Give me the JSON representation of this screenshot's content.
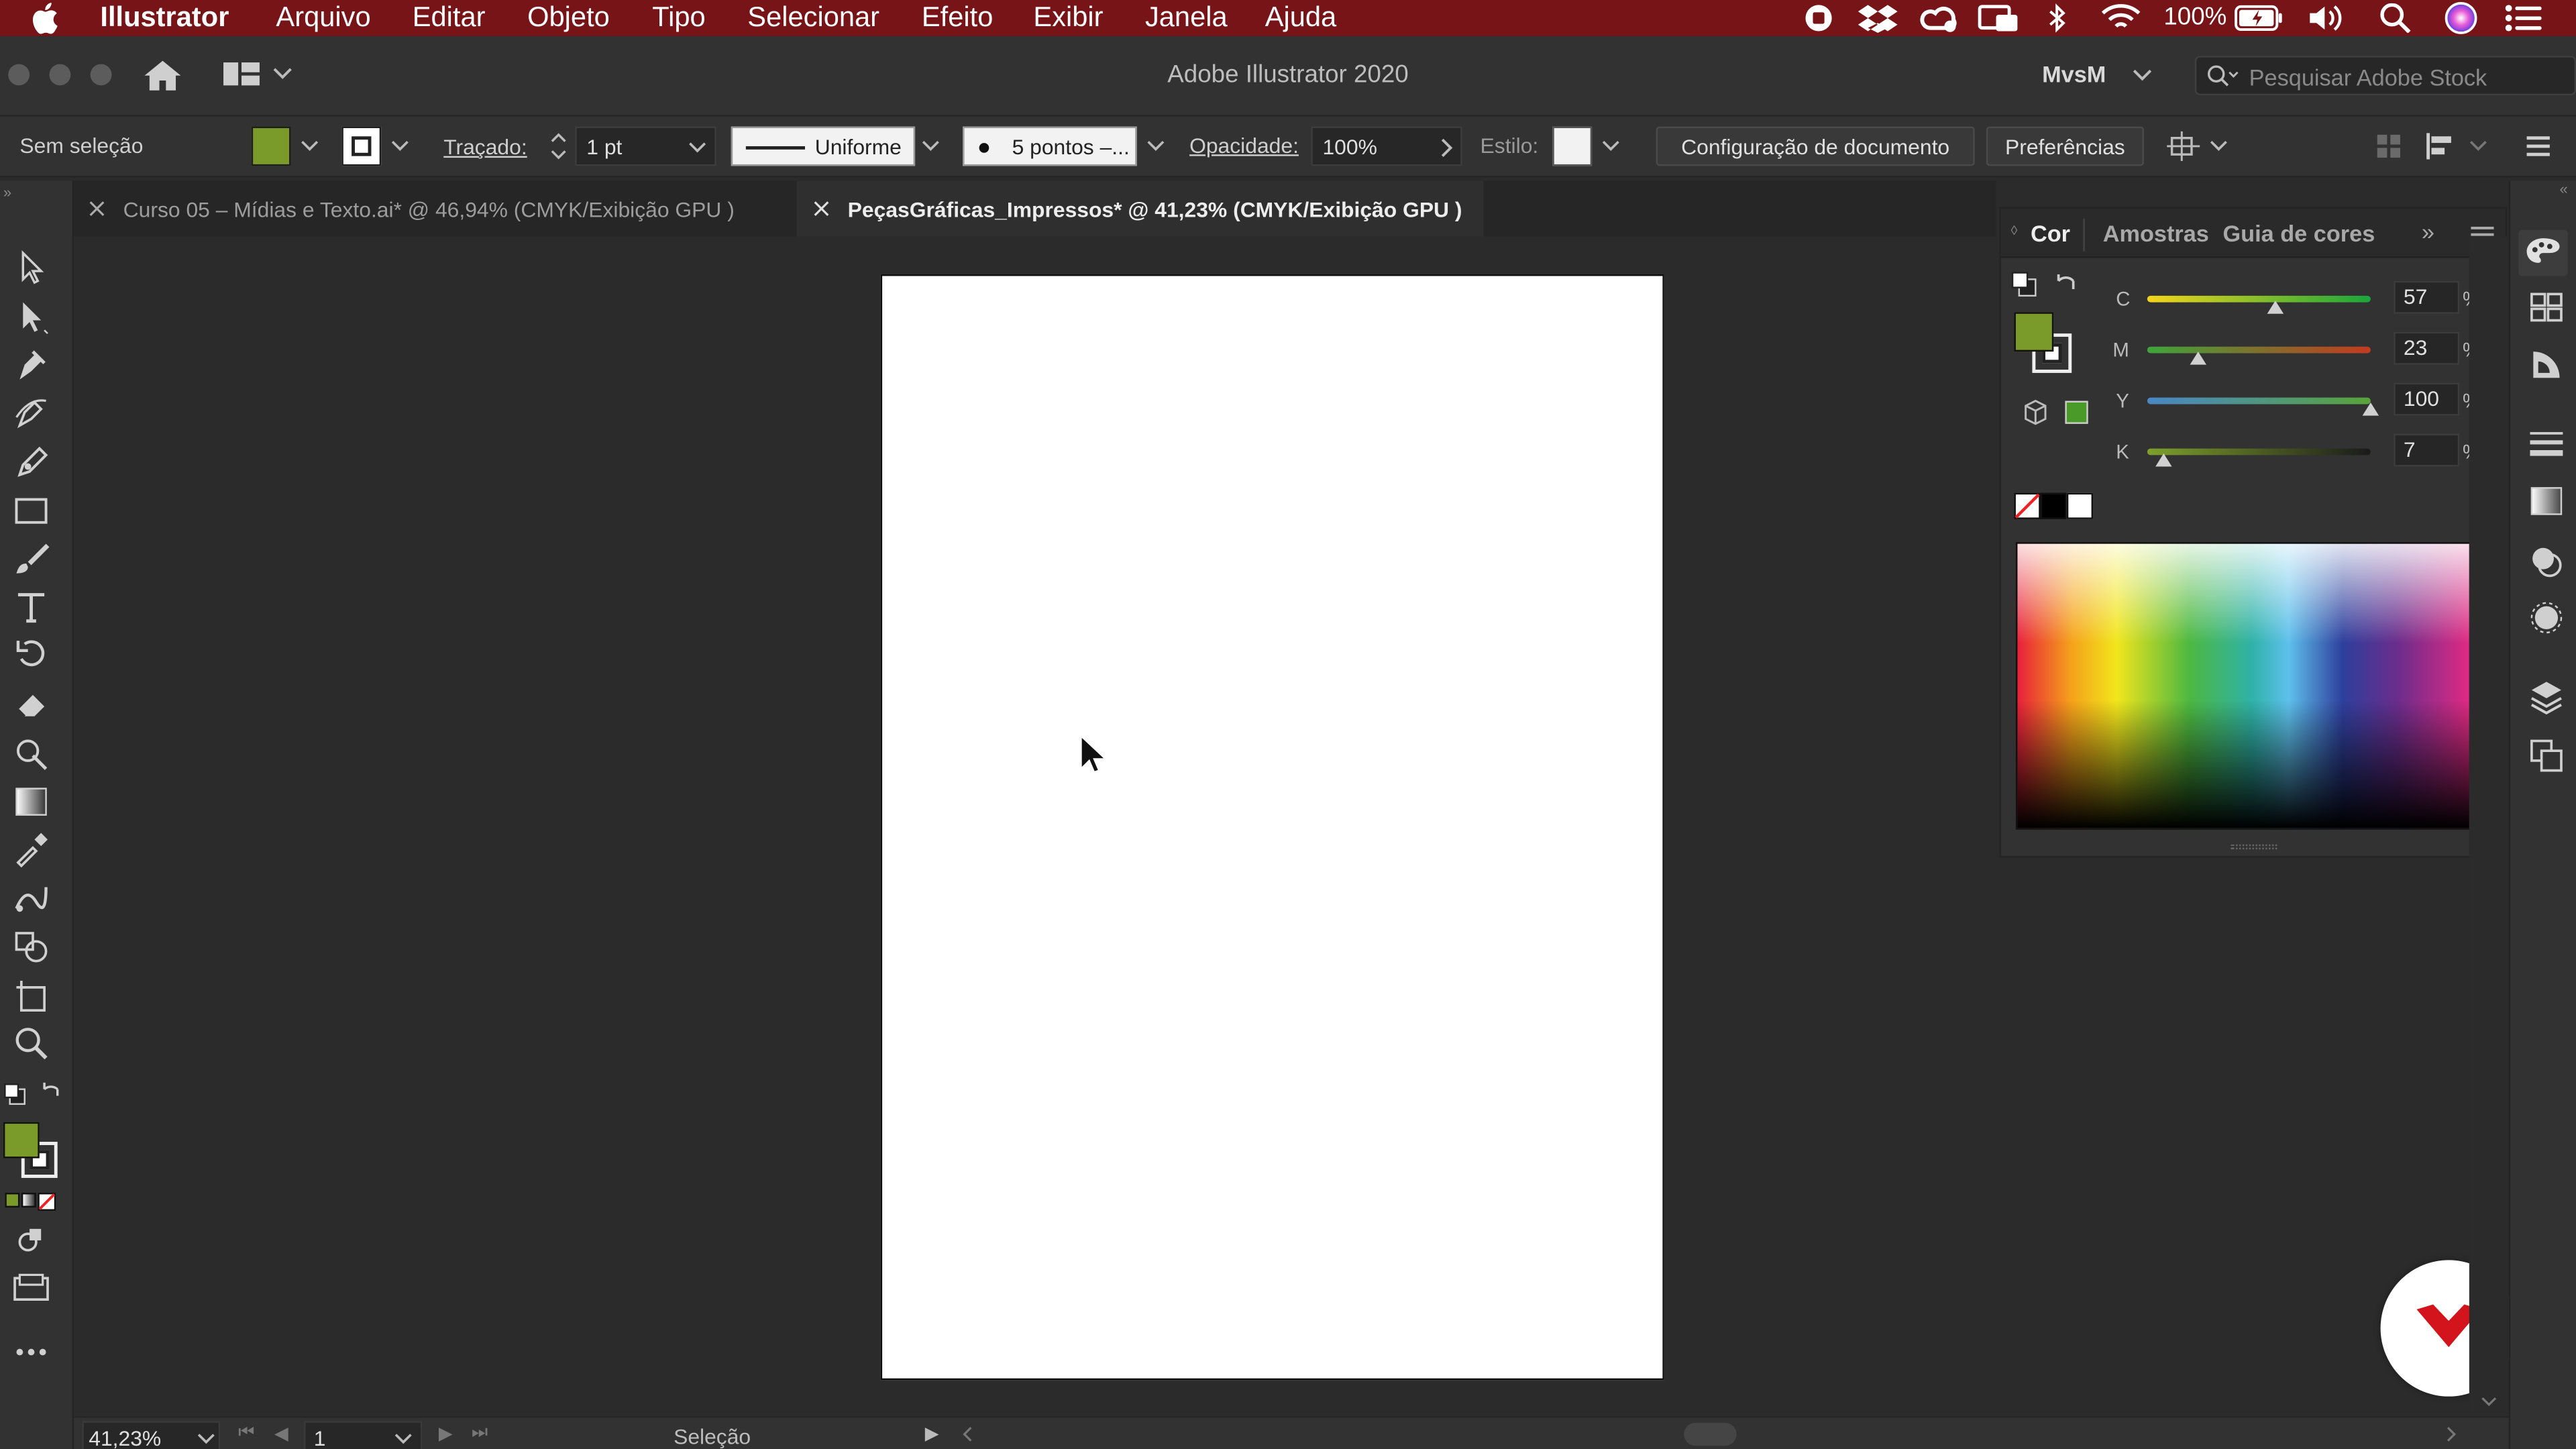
{
  "menubar": {
    "app_name": "Illustrator",
    "items": [
      "Arquivo",
      "Editar",
      "Objeto",
      "Tipo",
      "Selecionar",
      "Efeito",
      "Exibir",
      "Janela",
      "Ajuda"
    ],
    "battery": "100%",
    "background": "#761417"
  },
  "appbar": {
    "title": "Adobe Illustrator 2020",
    "workspace": "MvsM",
    "search_placeholder": "Pesquisar Adobe Stock"
  },
  "control_bar": {
    "selection": "Sem seleção",
    "stroke_label": "Traçado:",
    "stroke_value": "1 pt",
    "profile": "Uniforme",
    "brush": "5 pontos –...",
    "opacity_label": "Opacidade:",
    "opacity_value": "100%",
    "style_label": "Estilo:",
    "doc_setup_button": "Configuração de documento",
    "prefs_button": "Preferências",
    "fill_color": "#7a9a2a"
  },
  "tabs": [
    {
      "label": "Curso 05 – Mídias e Texto.ai* @ 46,94% (CMYK/Exibição GPU )",
      "active": false
    },
    {
      "label": "PeçasGráficas_Impressos* @ 41,23% (CMYK/Exibição GPU )",
      "active": true
    }
  ],
  "color_panel": {
    "tabs": [
      "Cor",
      "Amostras",
      "Guia de cores"
    ],
    "channels": [
      {
        "name": "C",
        "value": "57",
        "unit": "%",
        "level": 0.57
      },
      {
        "name": "M",
        "value": "23",
        "unit": "%",
        "level": 0.23
      },
      {
        "name": "Y",
        "value": "100",
        "unit": "%",
        "level": 1.0
      },
      {
        "name": "K",
        "value": "7",
        "unit": "%",
        "level": 0.07
      }
    ],
    "fill_color": "#7a9a2a"
  },
  "status_bar": {
    "zoom": "41,23%",
    "artboard_number": "1",
    "tool_name": "Seleção"
  }
}
